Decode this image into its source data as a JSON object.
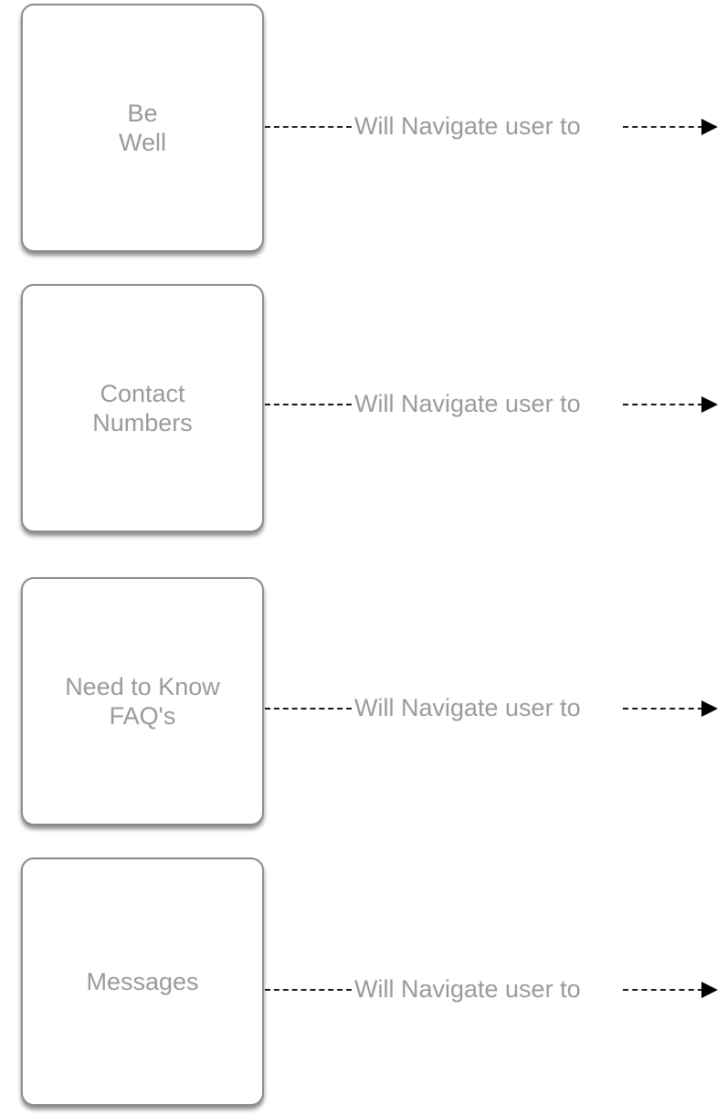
{
  "items": [
    {
      "label": "Be\nWell",
      "connector_text": "Will Navigate user to"
    },
    {
      "label": "Contact\nNumbers",
      "connector_text": "Will Navigate user to"
    },
    {
      "label": "Need to Know\nFAQ's",
      "connector_text": "Will Navigate user to"
    },
    {
      "label": "Messages",
      "connector_text": "Will Navigate user to"
    }
  ]
}
